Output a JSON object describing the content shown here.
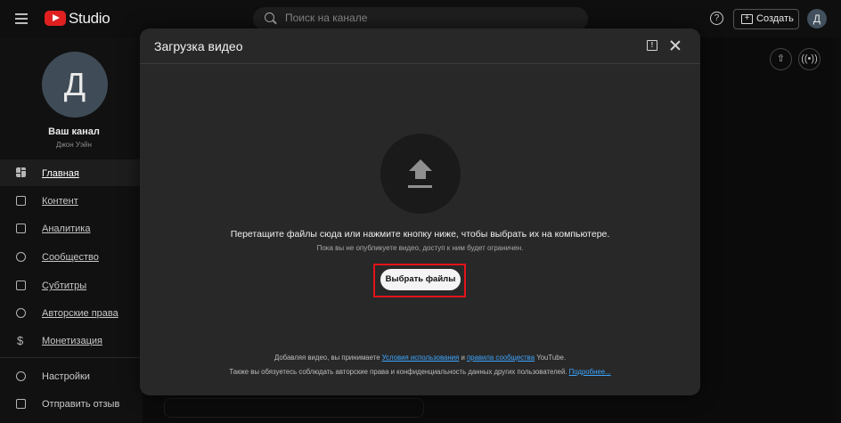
{
  "header": {
    "logo_text": "Studio",
    "search_placeholder": "Поиск на канале",
    "help_icon_glyph": "?",
    "create_label": "Создать",
    "avatar_letter": "Д"
  },
  "sidebar": {
    "avatar_letter": "Д",
    "channel_title": "Ваш канал",
    "channel_subtitle": "Джон Уэйн",
    "items": [
      {
        "label": "Главная",
        "icon": "dashboard-icon",
        "active": true
      },
      {
        "label": "Контент",
        "icon": "content-icon"
      },
      {
        "label": "Аналитика",
        "icon": "analytics-icon"
      },
      {
        "label": "Сообщество",
        "icon": "community-icon"
      },
      {
        "label": "Субтитры",
        "icon": "subtitles-icon"
      },
      {
        "label": "Авторские права",
        "icon": "copyright-icon"
      },
      {
        "label": "Монетизация",
        "icon": "monetization-icon"
      }
    ],
    "bottom_items": [
      {
        "label": "Настройки",
        "icon": "gear-icon"
      },
      {
        "label": "Отправить отзыв",
        "icon": "feedback-icon"
      }
    ]
  },
  "dialog": {
    "title": "Загрузка видео",
    "drop_text": "Перетащите файлы сюда или нажмите кнопку ниже, чтобы выбрать их на компьютере.",
    "drop_subtext": "Пока вы не опубликуете видео, доступ к ним будет ограничен.",
    "select_button": "Выбрать файлы",
    "terms_prefix": "Добавляя видео, вы принимаете",
    "terms_link": "Условия использования",
    "terms_and": "и",
    "community_link": "правила сообщества",
    "terms_suffix": "YouTube.",
    "privacy_text": "Также вы обязуетесь соблюдать авторские права и конфиденциальность данных других пользователей.",
    "more_link": "Подробнее..."
  },
  "colors": {
    "accent_red": "#e3141a",
    "link_blue": "#3ea6ff",
    "dialog_bg": "#282828"
  }
}
